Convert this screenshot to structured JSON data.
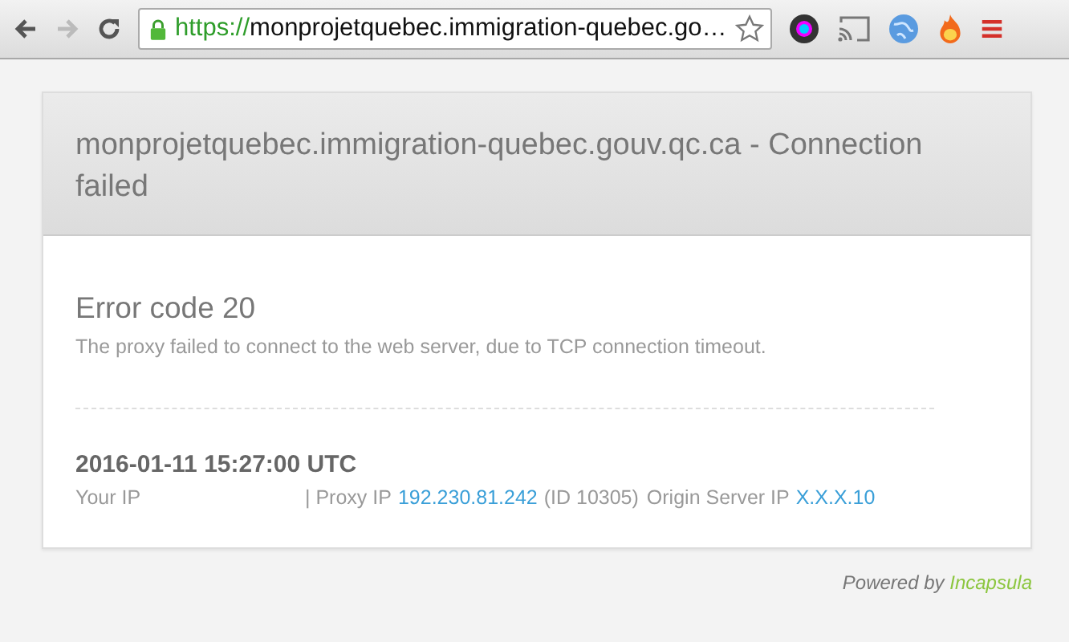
{
  "browser": {
    "back": {
      "disabled": false
    },
    "forward": {
      "disabled": true
    },
    "url": {
      "secure": true,
      "scheme": "https://",
      "rest": "monprojetquebec.immigration-quebec.go…"
    }
  },
  "card": {
    "title": "monprojetquebec.immigration-quebec.gouv.qc.ca - Connection failed",
    "error_title": "Error code 20",
    "error_message": "The proxy failed to connect to the web server, due to TCP connection timeout.",
    "timestamp": "2016-01-11 15:27:00 UTC",
    "info": [
      {
        "kind": "text",
        "text": "Your IP"
      },
      {
        "kind": "text",
        "text": "| Proxy IP"
      },
      {
        "kind": "link",
        "text": "192.230.81.242"
      },
      {
        "kind": "text",
        "text": "(ID 10305)"
      },
      {
        "kind": "text",
        "text": "Origin Server IP"
      },
      {
        "kind": "link",
        "text": "X.X.X.10"
      }
    ]
  },
  "footer": {
    "prefix": "Powered by",
    "brand": "Incapsula"
  }
}
